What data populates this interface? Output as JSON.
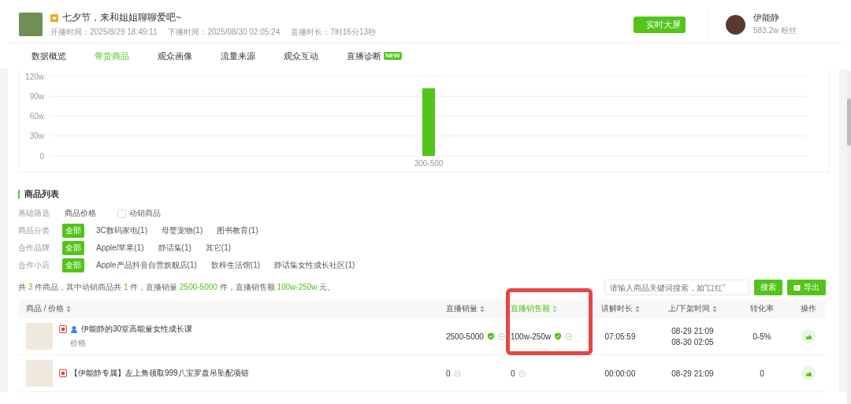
{
  "live": {
    "title": "七夕节，来和姐姐聊聊爱吧~",
    "start": "开播时间：2025/8/29 18:49:11",
    "end": "下播时间：2025/08/30 02:05:24",
    "duration": "直播时长：7时16分13秒"
  },
  "big_screen_button": "实时大屏",
  "anchor": {
    "name": "伊能静",
    "fans": "583.2w 粉丝"
  },
  "tabs": [
    {
      "label": "数据概览",
      "selected": false
    },
    {
      "label": "带货商品",
      "selected": true
    },
    {
      "label": "观众画像",
      "selected": false
    },
    {
      "label": "流量来源",
      "selected": false
    },
    {
      "label": "观众互动",
      "selected": false
    },
    {
      "label": "直播诊断",
      "selected": false,
      "badge": "NEW"
    }
  ],
  "chart_data": {
    "type": "bar",
    "grid": true,
    "categories": [
      "300-500"
    ],
    "values": [
      102
    ],
    "ylim": [
      0,
      120
    ],
    "yticks": [
      {
        "value": 0,
        "label": "0"
      },
      {
        "value": 30,
        "label": "30w"
      },
      {
        "value": 60,
        "label": "60w"
      },
      {
        "value": 90,
        "label": "90w"
      },
      {
        "value": 120,
        "label": "120w"
      }
    ]
  },
  "section_title": "商品列表",
  "basic_filter": {
    "label": "基础筛选",
    "price": "商品价格",
    "active_only": {
      "label": "动销商品",
      "checked": false
    }
  },
  "filter_groups": [
    {
      "label": "商品分类",
      "options": [
        {
          "label": "全部",
          "selected": true
        },
        {
          "label": "3C数码家电(1)",
          "selected": false
        },
        {
          "label": "母婴宠物(1)",
          "selected": false
        },
        {
          "label": "图书教育(1)",
          "selected": false
        }
      ]
    },
    {
      "label": "合作品牌",
      "options": [
        {
          "label": "全部",
          "selected": true
        },
        {
          "label": "Apple/苹果(1)",
          "selected": false
        },
        {
          "label": "静话集(1)",
          "selected": false
        },
        {
          "label": "其它(1)",
          "selected": false
        }
      ]
    },
    {
      "label": "合作小店",
      "options": [
        {
          "label": "全部",
          "selected": true
        },
        {
          "label": "Apple产品抖音自营旗舰店(1)",
          "selected": false
        },
        {
          "label": "歆梓生活馆(1)",
          "selected": false
        },
        {
          "label": "静话集女性成长社区(1)",
          "selected": false
        }
      ]
    }
  ],
  "summary": [
    {
      "text": "共 ",
      "highlight": false
    },
    {
      "text": "3",
      "highlight": true
    },
    {
      "text": " 件商品，其中动销商品共 ",
      "highlight": false
    },
    {
      "text": "1",
      "highlight": true
    },
    {
      "text": " 件，直播销量 ",
      "highlight": false
    },
    {
      "text": "2500-5000",
      "highlight": true
    },
    {
      "text": " 件，直播销售额 ",
      "highlight": false
    },
    {
      "text": "100w-250w",
      "highlight": true
    },
    {
      "text": " 元。",
      "highlight": false
    }
  ],
  "search": {
    "placeholder": "请输入商品关键词搜索，如“口红”",
    "button": "搜索"
  },
  "export_button": "导出",
  "columns": [
    {
      "label": "商品 / 价格",
      "sortable": true,
      "selected": false,
      "highlighted": false
    },
    {
      "label": "直播销量",
      "sortable": true,
      "selected": false,
      "highlighted": false
    },
    {
      "label": "直播销售额",
      "sortable": true,
      "selected": true,
      "highlighted": true
    },
    {
      "label": "讲解时长",
      "sortable": true,
      "selected": false,
      "highlighted": false
    },
    {
      "label": "上/下架时间",
      "sortable": true,
      "selected": false,
      "highlighted": false
    },
    {
      "label": "转化率",
      "sortable": false,
      "selected": false,
      "highlighted": false
    },
    {
      "label": "操作",
      "sortable": false,
      "selected": false,
      "highlighted": false
    }
  ],
  "rows": [
    {
      "name": "伊能静的30堂高能量女性成长课",
      "price": "价格",
      "member_icon": true,
      "sales": "2500-5000",
      "sales_verified": true,
      "revenue": "100w-250w",
      "revenue_verified": true,
      "explain": "07:05:59",
      "times": [
        "08-29 21:09",
        "08-30 02:05"
      ],
      "conversion": "0-5%"
    },
    {
      "name": "【伊能静专属】左上角领取999八宝罗盘吊坠配项链",
      "member_icon": false,
      "sales": "0",
      "sales_verified": false,
      "revenue": "0",
      "revenue_verified": false,
      "explain": "00:00:00",
      "times": [
        "08-29 21:09"
      ],
      "conversion": "0"
    }
  ]
}
